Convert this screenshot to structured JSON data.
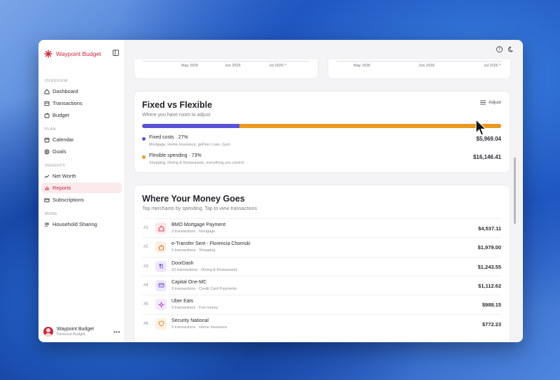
{
  "sidebar": {
    "brand": "Waypoint Budget",
    "sections": [
      {
        "label": "OVERVIEW",
        "items": [
          "Dashboard",
          "Transactions",
          "Budget"
        ]
      },
      {
        "label": "PLAN",
        "items": [
          "Calendar",
          "Goals"
        ]
      },
      {
        "label": "INSIGHTS",
        "items": [
          "Net Worth",
          "Reports",
          "Subscriptions"
        ]
      },
      {
        "label": "MORE",
        "items": [
          "Household Sharing"
        ]
      }
    ],
    "active_item": "Reports",
    "user": {
      "name": "Waypoint Budget",
      "subtitle": "Personal Budget",
      "more": "•••"
    }
  },
  "charts_top": {
    "left_ticks": [
      "May 2026",
      "Jun 2026",
      "Jul 2026 *"
    ],
    "right_ticks": [
      "May 2026",
      "Jun 2026",
      "Jul 2026 *"
    ]
  },
  "fixed_flexible": {
    "title": "Fixed vs Flexible",
    "subtitle": "Where you have room to adjust",
    "adjust_label": "Adjust",
    "fixed_fraction": 0.27,
    "fixed": {
      "label": "Fixed costs · 27%",
      "desc": "Mortgage, Home Insurance, goPeer Loan, Gym",
      "amount": "$5,969.04",
      "color": "#5b53d6"
    },
    "flexible": {
      "label": "Flexible spending · 73%",
      "desc": "Shopping, Dining & Restaurants, everything you control",
      "amount": "$16,146.41",
      "color": "#e99a1f"
    }
  },
  "where": {
    "title": "Where Your Money Goes",
    "subtitle": "Top merchants by spending. Tap to view transactions",
    "merchants": [
      {
        "rank": "#1",
        "name": "BMO Mortgage Payment",
        "desc": "3 transactions · Mortgage",
        "amount": "$4,537.11",
        "icon": "home-icon",
        "bg": "#fde7e9",
        "fg": "#d2404f"
      },
      {
        "rank": "#2",
        "name": "e-Transfer Sent - Florencia Chomski",
        "desc": "5 transactions · Shopping",
        "amount": "$1,979.00",
        "icon": "shopping-bag-icon",
        "bg": "#fdeee3",
        "fg": "#e07a3a"
      },
      {
        "rank": "#3",
        "name": "DoorDash",
        "desc": "23 transactions · Dining & Restaurants",
        "amount": "$1,243.55",
        "icon": "utensils-icon",
        "bg": "#efe8fb",
        "fg": "#7a55cc"
      },
      {
        "rank": "#4",
        "name": "Capital One-MC",
        "desc": "3 transactions · Credit Card Payments",
        "amount": "$1,112.62",
        "icon": "credit-card-icon",
        "bg": "#efe8fb",
        "fg": "#7a55cc"
      },
      {
        "rank": "#5",
        "name": "Uber Eats",
        "desc": "9 transactions · Fun money",
        "amount": "$988.15",
        "icon": "sparkle-icon",
        "bg": "#f6e8fb",
        "fg": "#a04fc4"
      },
      {
        "rank": "#6",
        "name": "Security National",
        "desc": "6 transactions · Home Insurance",
        "amount": "$772.23",
        "icon": "shield-icon",
        "bg": "#fdf1e3",
        "fg": "#e0903a"
      }
    ]
  }
}
